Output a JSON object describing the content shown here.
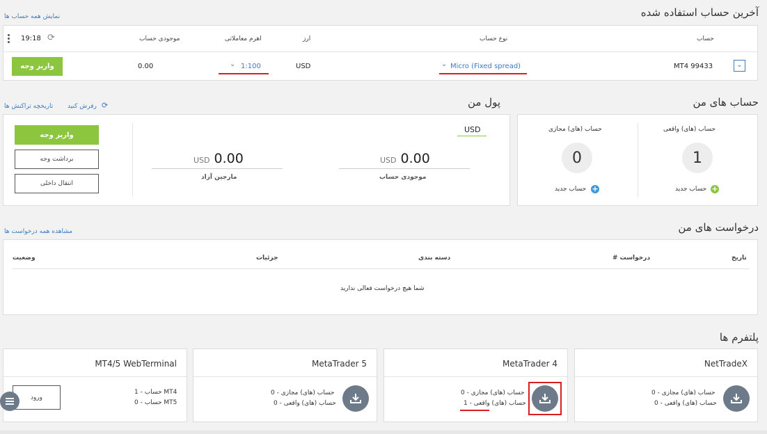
{
  "last_account": {
    "title": "آخرین حساب استفاده شده",
    "show_all_link": "نمایش همه حساب ها",
    "time": "19:18",
    "headers": {
      "account": "حساب",
      "account_type": "نوع حساب",
      "currency": "ارز",
      "leverage": "اهرم معاملاتی",
      "balance": "موجودی حساب"
    },
    "row": {
      "account": "MT4 99433",
      "account_type": "Micro (Fixed spread)",
      "currency": "USD",
      "leverage": "1:100",
      "balance": "0.00",
      "deposit_label": "واریز وجه"
    }
  },
  "my_accounts": {
    "title": "حساب های من",
    "real_label": "حساب (های) واقعی",
    "real_count": "1",
    "demo_label": "حساب (های) مجازی",
    "demo_count": "0",
    "new_account": "حساب جدید",
    "colors": {
      "real_plus": "#8cc63f",
      "demo_plus": "#3d9ad9"
    }
  },
  "my_money": {
    "title": "پول من",
    "history_link": "تاریخچه تراکنش ها",
    "refresh_link": "رفرش کنید",
    "currency_tab": "USD",
    "balance_currency": "USD",
    "balance_value": "0.00",
    "balance_label": "موجودی حساب",
    "margin_currency": "USD",
    "margin_value": "0.00",
    "margin_label": "مارجین آزاد",
    "deposit": "واریز وجه",
    "withdraw": "برداشت وجه",
    "internal_transfer": "انتقال داخلی"
  },
  "requests": {
    "title": "درخواست های من",
    "view_all": "مشاهده همه درخواست ها",
    "headers": {
      "date": "تاریخ",
      "request_no": "درخواست #",
      "category": "دسته بندی",
      "details": "جزئیات",
      "status": "وضعیت"
    },
    "empty": "شما هیچ درخواست فعالی ندارید"
  },
  "platforms": {
    "title": "پلتفرم ها",
    "items": [
      {
        "name": "NetTradeX",
        "demo": "حساب (های) مجازی - 0",
        "real": "حساب (های) واقعی - 0"
      },
      {
        "name": "MetaTrader 4",
        "demo": "حساب (های) مجازی - 0",
        "real": "حساب (های) واقعی - 1"
      },
      {
        "name": "MetaTrader 5",
        "demo": "حساب (های) مجازی - 0",
        "real": "حساب (های) واقعی - 0"
      },
      {
        "name": "MT4/5 WebTerminal",
        "mt4": "MT4 حساب - 1",
        "mt5": "MT5 حساب - 0",
        "login": "ورود"
      }
    ]
  },
  "colors": {
    "accent_green": "#8cc63f",
    "link_blue": "#3d7bbf",
    "highlight_red": "#d81e1e"
  }
}
